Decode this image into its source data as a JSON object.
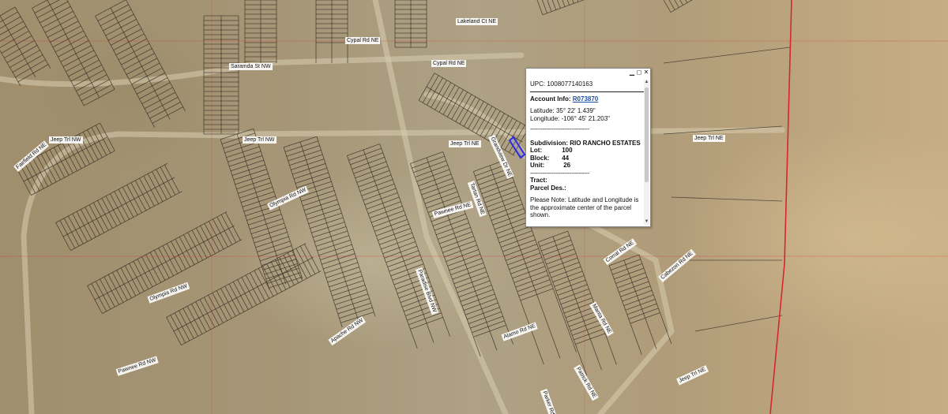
{
  "popup": {
    "upc_label": "UPC:",
    "upc_value": "1008077140163",
    "account_label": "Account Info:",
    "account_value": "R073870",
    "latitude_label": "Latitude:",
    "latitude_value": "35° 22' 1.439\"",
    "longitude_label": "Longitude:",
    "longitude_value": "-106° 45' 21.203\"",
    "separator": "---------------------------------",
    "subdivision_label": "Subdivision:",
    "subdivision_value": "RIO RANCHO ESTATES",
    "lot_label": "Lot:",
    "lot_value": "100",
    "block_label": "Block:",
    "block_value": "44",
    "unit_label": "Unit:",
    "unit_value": "26",
    "tract_label": "Tract:",
    "parcel_des_label": "Parcel Des.:",
    "note": "Please Note: Latitude and Longitude is the approximate center of the parcel shown.",
    "minimize_icon": "minimize-icon",
    "maximize_icon": "maximize-icon",
    "close_icon": "close-icon"
  },
  "street_labels": [
    "Cypal Rd NE",
    "Cypal Rd NE",
    "Jeep Trl NW",
    "Jeep Trl NW",
    "Jeep Trl NE",
    "Jeep Trl NE",
    "Pawnee Rd NE",
    "Pawnee Rd NW",
    "Olympia Rd NW",
    "Olympia Rd NW",
    "Saramda St NW",
    "Paradise Blvd NW",
    "Grandview Dr NE",
    "Tartan Rd NE",
    "Manta Rd NE",
    "Alamo Rd NE",
    "Apache Rd NW",
    "Fairfield Rd NE",
    "Corral Rd NE",
    "Cabezon Rd NE",
    "Patrick Rd NE",
    "Parker Rd NE",
    "Jeep Trl NE",
    "Lakeland Ct NE"
  ],
  "colors": {
    "parcel_line": "#2e2a22",
    "boundary_red": "#d8262a",
    "highlight_parcel": "#2b2be0",
    "link": "#1b4fa0"
  }
}
